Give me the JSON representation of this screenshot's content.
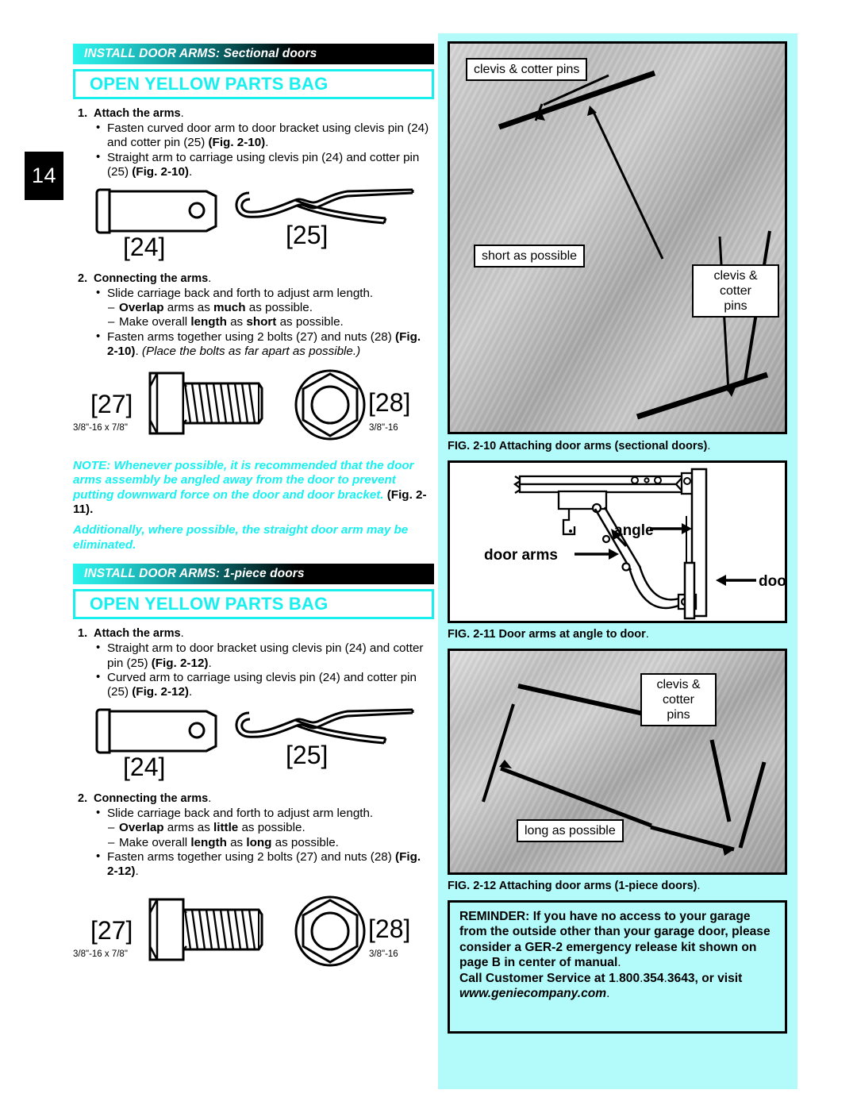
{
  "page": {
    "number": "14"
  },
  "sections": [
    {
      "band_title_strong": "INSTALL DOOR ARMS:",
      "band_title_rest": " Sectional doors",
      "bag_label": "OPEN YELLOW PARTS BAG",
      "step1_num": "1.",
      "step1_title": "Attach the arms",
      "step1_period": ".",
      "step1_bullets": [
        "Fasten curved door arm to door bracket using clevis pin (24) and cotter pin (25) (Fig. 2-10).",
        "Straight arm to carriage using clevis pin (24) and cotter pin (25) (Fig. 2-10)."
      ],
      "parts_a": {
        "left_label": "[24]",
        "right_label": "[25]"
      },
      "step2_num": "2.",
      "step2_title": "Connecting the arms",
      "step2_period": ".",
      "step2_bullets": [
        "Slide carriage back and forth to adjust arm length.",
        "Overlap arms as much as possible.",
        "Make overall length as short as possible.",
        "Fasten arms together using 2 bolts (27) and nuts (28) (Fig. 2-10). (Place the bolts as far apart as possible.)"
      ],
      "parts_b": {
        "bolt_label": "[27]",
        "bolt_spec": "3/8\"-16 x 7/8\"",
        "nut_label": "[28]",
        "nut_spec": "3/8\"-16"
      }
    },
    {
      "band_title_strong": "INSTALL DOOR ARMS:",
      "band_title_rest": " 1-piece doors",
      "bag_label": "OPEN YELLOW PARTS BAG",
      "step1_num": "1.",
      "step1_title": "Attach the arms",
      "step1_period": ".",
      "step1_bullets": [
        "Straight arm to door bracket using clevis pin (24) and cotter pin (25) (Fig. 2-12).",
        "Curved arm to carriage using clevis pin (24) and cotter pin (25) (Fig. 2-12)."
      ],
      "parts_a": {
        "left_label": "[24]",
        "right_label": "[25]"
      },
      "step2_num": "2.",
      "step2_title": "Connecting the arms",
      "step2_period": ".",
      "step2_bullets": [
        "Slide carriage back and forth to adjust arm length.",
        "Overlap arms as little as possible.",
        "Make overall length as long as possible.",
        "Fasten arms together using 2 bolts (27) and nuts (28) (Fig. 2-12)."
      ],
      "parts_b": {
        "bolt_label": "[27]",
        "bolt_spec": "3/8\"-16 x 7/8\"",
        "nut_label": "[28]",
        "nut_spec": "3/8\"-16"
      }
    }
  ],
  "note": {
    "p1_a": "NOTE: Whenever possible, it is recommended that the door arms assembly be angled away from the door to prevent putting downward force on the door and door bracket. ",
    "p1_b": "(Fig. 2-11)",
    "p1_c": ".",
    "p2": "Additionally, where possible, the straight door arm may be eliminated."
  },
  "figures": {
    "fig210": {
      "caption_bold": "FIG. 2-10  Attaching door arms (sectional doors)",
      "caption_tail": ".",
      "callouts": {
        "top_left": "clevis & cotter pins",
        "middle": "short as possible",
        "right": "clevis &\ncotter\npins"
      }
    },
    "fig211": {
      "caption_bold": "FIG. 2-11  Door arms at angle to door",
      "caption_tail": ".",
      "labels": {
        "angle": "angle",
        "door_arms": "door arms",
        "door": "door"
      }
    },
    "fig212": {
      "caption_bold": "FIG. 2-12  Attaching door arms (1-piece doors)",
      "caption_tail": ".",
      "callouts": {
        "right": "clevis &\ncotter\npins",
        "bottom": "long as possible"
      }
    }
  },
  "reminder": {
    "line1": "REMINDER: If you have no access to your garage from the outside other than your garage door, please consider a GER-2 emergency release kit shown on page B in center of manual",
    "line1_tail": ".",
    "line2_a": "Call Customer Service at 1",
    "line2_dot1": ".",
    "line2_b": "800",
    "line2_dot2": ".",
    "line2_c": "354",
    "line2_dot3": ".",
    "line2_d": "3643, or visit ",
    "line2_url": "www.geniecompany.com",
    "line2_tail": "."
  },
  "colors": {
    "cyan": "#18f0f0",
    "panel": "#b3fbfb",
    "black": "#000000"
  }
}
